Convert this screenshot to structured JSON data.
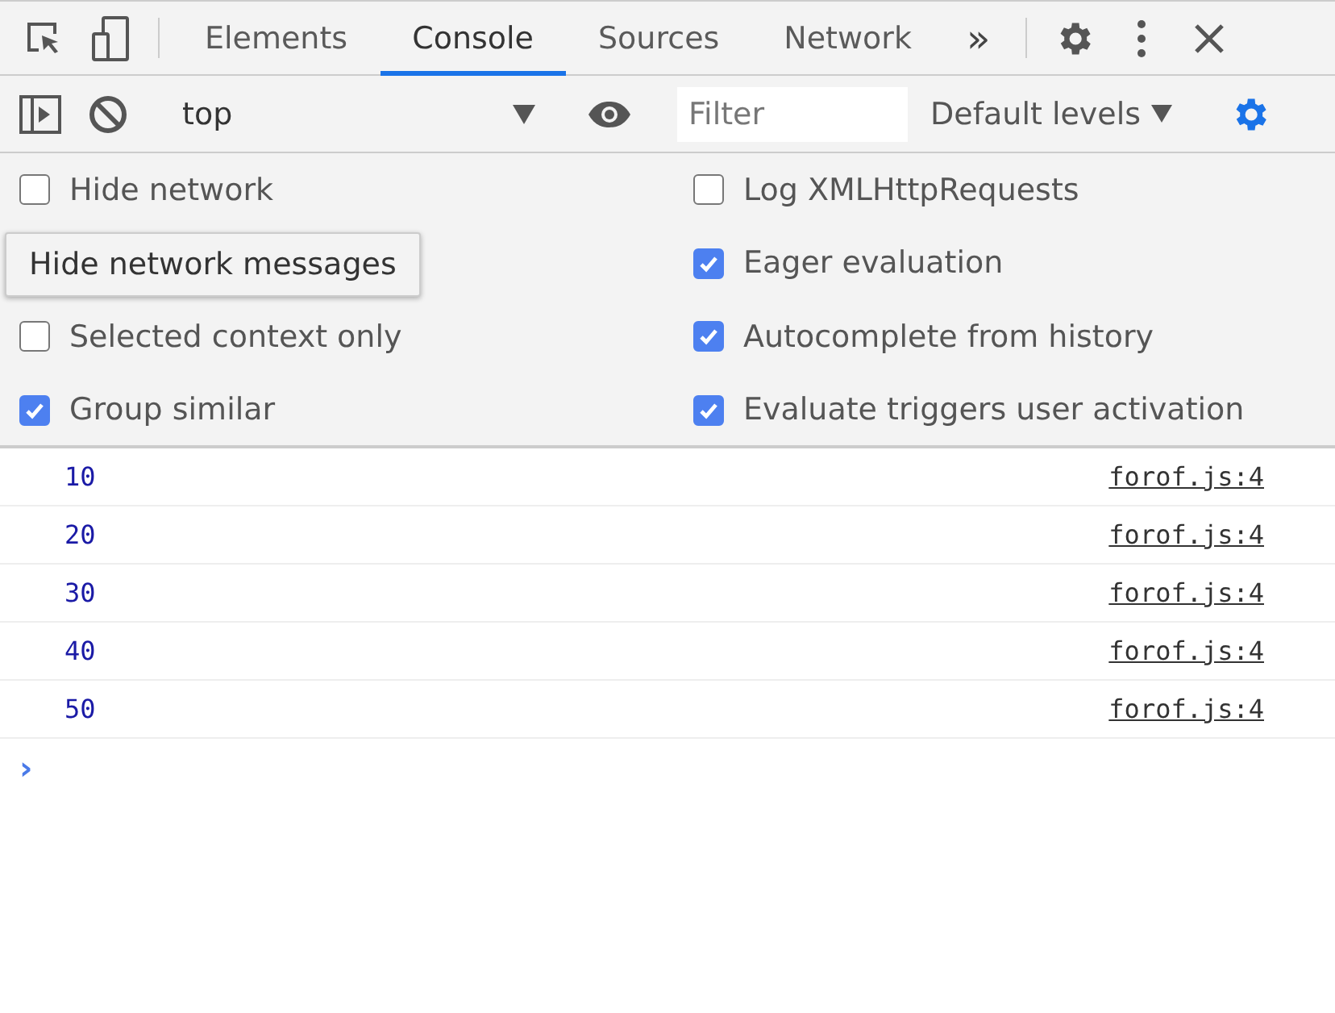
{
  "tabs": [
    {
      "label": "Elements",
      "selected": false
    },
    {
      "label": "Console",
      "selected": true
    },
    {
      "label": "Sources",
      "selected": false
    },
    {
      "label": "Network",
      "selected": false
    }
  ],
  "more_tabs": "»",
  "toolbar": {
    "context": "top",
    "filter_placeholder": "Filter",
    "levels": "Default levels",
    "settings_active": true
  },
  "settings": {
    "left": [
      {
        "label": "Hide network",
        "checked": false
      },
      {
        "label": "Selected context only",
        "checked": false
      },
      {
        "label": "Group similar",
        "checked": true
      }
    ],
    "right": [
      {
        "label": "Log XMLHttpRequests",
        "checked": false
      },
      {
        "label": "Eager evaluation",
        "checked": true
      },
      {
        "label": "Autocomplete from history",
        "checked": true
      },
      {
        "label": "Evaluate triggers user activation",
        "checked": true
      }
    ],
    "tooltip": "Hide network messages"
  },
  "console": {
    "rows": [
      {
        "value": "10",
        "source": "forof.js:4"
      },
      {
        "value": "20",
        "source": "forof.js:4"
      },
      {
        "value": "30",
        "source": "forof.js:4"
      },
      {
        "value": "40",
        "source": "forof.js:4"
      },
      {
        "value": "50",
        "source": "forof.js:4"
      }
    ],
    "prompt": "›"
  }
}
